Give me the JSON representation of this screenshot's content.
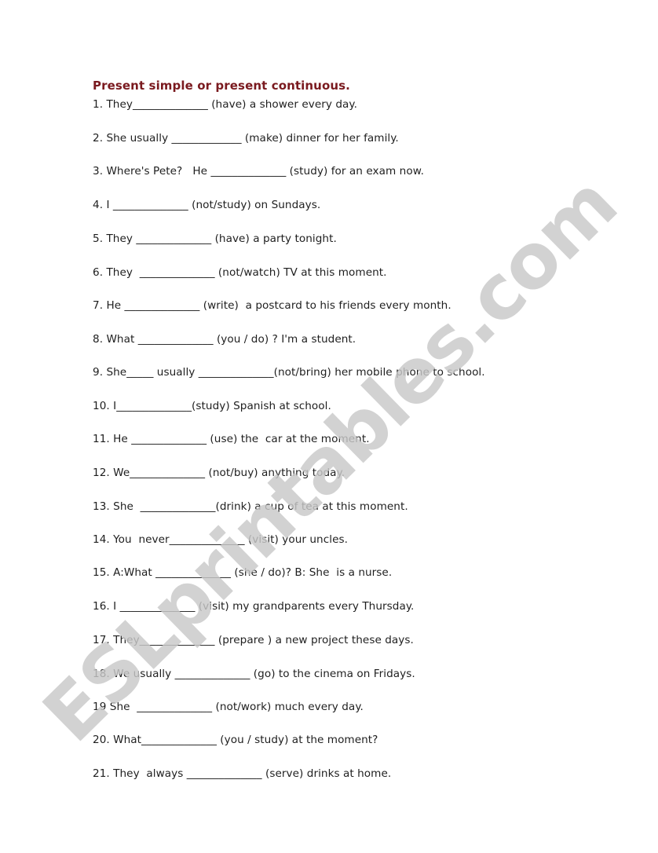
{
  "worksheet": {
    "title": "Present simple or present continuous.",
    "watermark": "ESLprintables.com",
    "title_color": "#7a1a1f",
    "items": [
      "1. They______________ (have) a shower every day.",
      "2. She usually _____________ (make) dinner for her family.",
      "3. Where's Pete?   He ______________ (study) for an exam now.",
      "4. I ______________ (not/study) on Sundays.",
      "5. They ______________ (have) a party tonight.",
      "6. They  ______________ (not/watch) TV at this moment.",
      "7. He ______________ (write)  a postcard to his friends every month.",
      "8. What ______________ (you / do) ? I'm a student.",
      "9. She_____ usually ______________(not/bring) her mobile phone to school.",
      "10. I______________(study) Spanish at school.",
      "11. He ______________ (use) the  car at the moment.",
      "12. We______________ (not/buy) anything today.",
      "13. She  ______________(drink) a cup of tea at this moment.",
      "14. You  never______________ (visit) your uncles.",
      "15. A:What ______________ (she / do)? B: She  is a nurse.",
      "16. I ______________ (visit) my grandparents every Thursday.",
      "17. They______________ (prepare ) a new project these days.",
      "18. We usually ______________ (go) to the cinema on Fridays.",
      "19 She  ______________ (not/work) much every day.",
      "20. What______________ (you / study) at the moment?",
      "21. They  always ______________ (serve) drinks at home."
    ]
  }
}
